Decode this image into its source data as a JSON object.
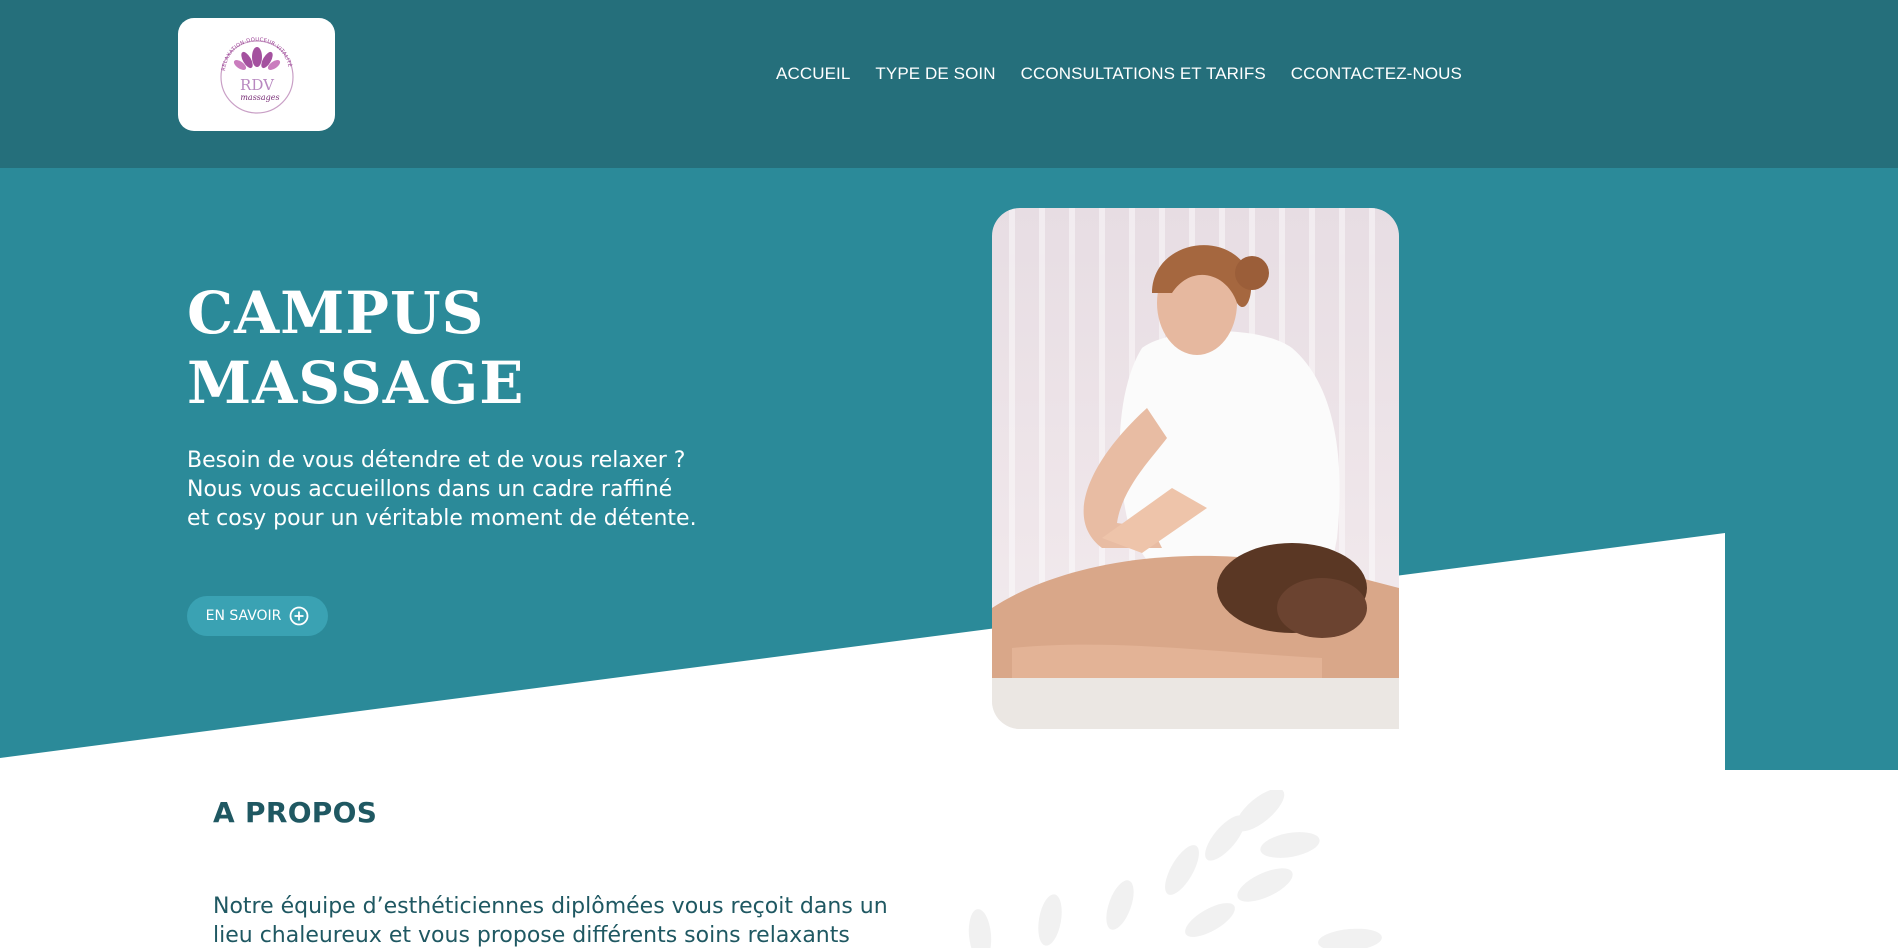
{
  "header": {
    "logo": {
      "name": "rdv-massages-logo",
      "arc_text": "RELAXATION·DOUCEUR·VITALITÉ",
      "main_text": "RDV",
      "sub_text": "massages"
    },
    "nav": [
      {
        "label": "ACCUEIL"
      },
      {
        "label": "TYPE DE SOIN"
      },
      {
        "label": "CCONSULTATIONS ET TARIFS"
      },
      {
        "label": "CCONTACTEZ-NOUS"
      }
    ]
  },
  "hero": {
    "title_line1": "CAMPUS",
    "title_line2": "MASSAGE",
    "text_line1": "Besoin de vous détendre et de vous relaxer ?",
    "text_line2": "Nous vous accueillons dans un cadre raffiné",
    "text_line3": "et cosy pour un véritable moment de détente.",
    "cta_label": "EN SAVOIR",
    "cta_icon": "plus-circle-icon",
    "photo": "massage-photo"
  },
  "about": {
    "title": "A PROPOS",
    "text_line1": "Notre équipe d’esthéticiennes diplômées vous reçoit dans un",
    "text_line2": "lieu chaleureux et vous propose différents soins relaxants"
  },
  "colors": {
    "header_bg": "#256f7b",
    "hero_bg": "#2b8a99",
    "button_bg": "#3aa2b3",
    "text_dark": "#1f5862",
    "logo_purple": "#9b3f95"
  }
}
